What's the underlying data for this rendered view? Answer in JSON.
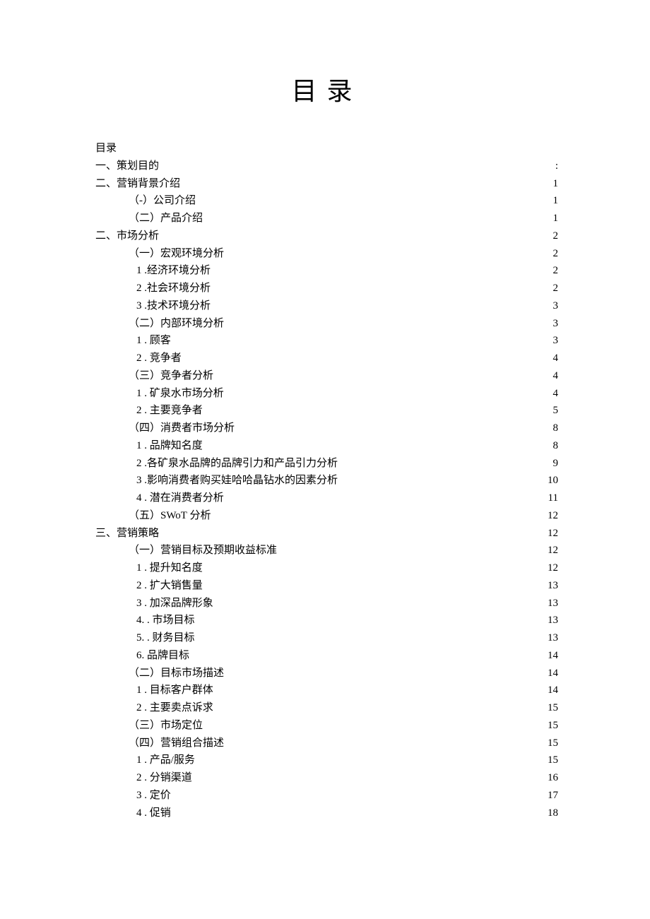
{
  "title": "目录",
  "toc": [
    {
      "label": "目录",
      "page": "",
      "level": 0
    },
    {
      "label": "一、策划目的",
      "page": ":",
      "level": 0
    },
    {
      "label": "二、营销背景介绍",
      "page": "1",
      "level": 0
    },
    {
      "label": "（-）公司介绍",
      "page": "1",
      "level": 1
    },
    {
      "label": "（二）产品介绍",
      "page": "1",
      "level": 1
    },
    {
      "label": "二、市场分析",
      "page": "2",
      "level": 0
    },
    {
      "label": "（一）宏观环境分析",
      "page": "2",
      "level": 1
    },
    {
      "label": "1  .经济环境分析 ",
      "page": "2",
      "level": 2
    },
    {
      "label": "2  .社会环境分析",
      "page": "2",
      "level": 2
    },
    {
      "label": "3  .技术环境分析 ",
      "page": "3",
      "level": 2
    },
    {
      "label": "（二）内部环境分析",
      "page": "3",
      "level": 1
    },
    {
      "label": "1 . 顾客",
      "page": "3",
      "level": 2
    },
    {
      "label": "2  . 竞争者",
      "page": "4",
      "level": 2
    },
    {
      "label": "（三）竞争者分析",
      "page": "4",
      "level": 1
    },
    {
      "label": "1 . 矿泉水市场分析",
      "page": "4",
      "level": 2
    },
    {
      "label": "2  . 主要竞争者 ",
      "page": "5",
      "level": 2
    },
    {
      "label": "（四）消费者市场分析",
      "page": "8",
      "level": 1
    },
    {
      "label": "1 . 品牌知名度",
      "page": "8",
      "level": 2
    },
    {
      "label": "2  .各矿泉水品牌的品牌引力和产品引力分析",
      "page": "9",
      "level": 2
    },
    {
      "label": "3  .影响消费者购买娃哈哈晶钻水的因素分析 ",
      "page": "10",
      "level": 2
    },
    {
      "label": "4  . 潜在消费者分析 ",
      "page": "11",
      "level": 2
    },
    {
      "label": "（五）SWoT 分析 ",
      "page": "12",
      "level": 1
    },
    {
      "label": "三、营销策略",
      "page": "12",
      "level": 0
    },
    {
      "label": "（一）营销目标及预期收益标准",
      "page": "12",
      "level": 1
    },
    {
      "label": "1 . 提升知名度",
      "page": "12",
      "level": 2
    },
    {
      "label": "2  . 扩大销售量 ",
      "page": "13",
      "level": 2
    },
    {
      "label": "3  . 加深品牌形象",
      "page": "13",
      "level": 2
    },
    {
      "label": "4. . 市场目标 ",
      "page": "13",
      "level": 2
    },
    {
      "label": "5. . 财务目标 ",
      "page": "13",
      "level": 2
    },
    {
      "label": "6. 品牌目标 ",
      "page": "14",
      "level": 2
    },
    {
      "label": "（二）目标市场描述",
      "page": "14",
      "level": 1
    },
    {
      "label": "1 . 目标客户群体 ",
      "page": "14",
      "level": 2
    },
    {
      "label": "2  . 主要卖点诉求",
      "page": "15",
      "level": 2
    },
    {
      "label": "（三）市场定位",
      "page": "15",
      "level": 1
    },
    {
      "label": "（四）营销组合描述",
      "page": "15",
      "level": 1
    },
    {
      "label": "1 . 产品/服务",
      "page": "15",
      "level": 2
    },
    {
      "label": "2  . 分销渠道 ",
      "page": "16",
      "level": 2
    },
    {
      "label": "3  . 定价 ",
      "page": "17",
      "level": 2
    },
    {
      "label": "4  . 促销 ",
      "page": "18",
      "level": 2
    }
  ]
}
